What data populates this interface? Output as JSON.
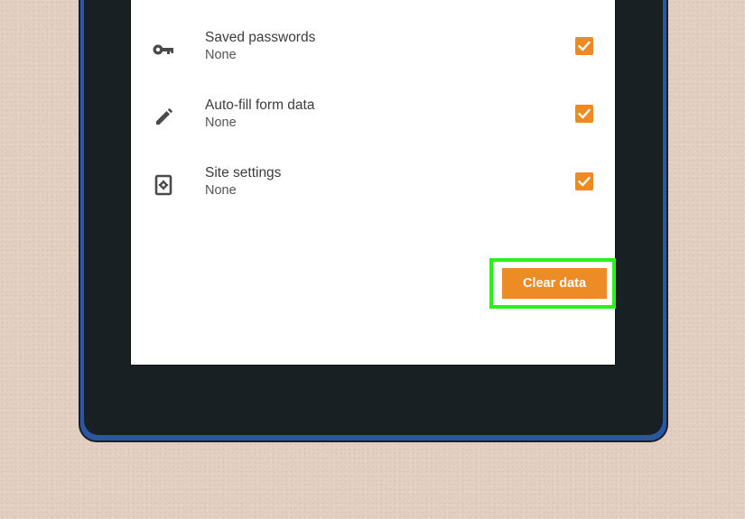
{
  "settings": {
    "items": [
      {
        "title": "Saved passwords",
        "subtitle": "None",
        "icon": "key-icon",
        "checked": true
      },
      {
        "title": "Auto-fill form data",
        "subtitle": "None",
        "icon": "pencil-icon",
        "checked": true
      },
      {
        "title": "Site settings",
        "subtitle": "None",
        "icon": "site-settings-icon",
        "checked": true
      }
    ]
  },
  "actions": {
    "clear_label": "Clear data"
  },
  "colors": {
    "accent": "#ed8c24",
    "highlight": "#29f21b",
    "device_frame": "#2b56a5",
    "bezel": "#182023",
    "background": "#e3cfc1"
  }
}
